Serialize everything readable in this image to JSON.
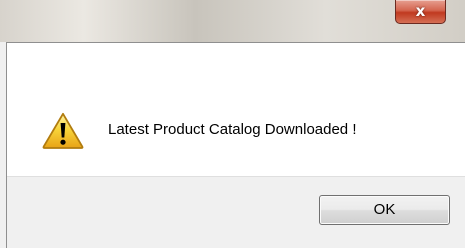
{
  "window": {
    "close_glyph": "x"
  },
  "dialog": {
    "message": "Latest Product Catalog Downloaded !",
    "icon": "warning-icon",
    "ok_label": "OK"
  },
  "colors": {
    "close_button": "#c9482f",
    "warning_fill": "#f8d43b",
    "warning_border": "#b17c0f"
  }
}
